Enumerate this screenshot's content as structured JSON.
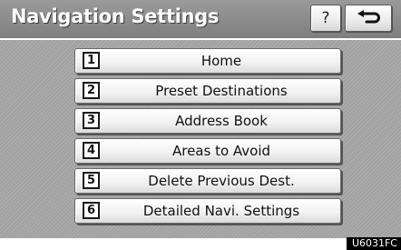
{
  "header": {
    "title": "Navigation Settings",
    "help_label": "?",
    "back_icon": "back-arrow-icon"
  },
  "menu": {
    "items": [
      {
        "number": "1",
        "label": "Home"
      },
      {
        "number": "2",
        "label": "Preset Destinations"
      },
      {
        "number": "3",
        "label": "Address Book"
      },
      {
        "number": "4",
        "label": "Areas to Avoid"
      },
      {
        "number": "5",
        "label": "Delete Previous Dest."
      },
      {
        "number": "6",
        "label": "Detailed Navi. Settings"
      }
    ]
  },
  "footer": {
    "image_code": "U6031FC"
  },
  "colors": {
    "screen_background": "#a9a9a9",
    "title_bar": "#8a8a8a",
    "button_face": "#f2f2f2",
    "image_code_background": "#000000"
  }
}
